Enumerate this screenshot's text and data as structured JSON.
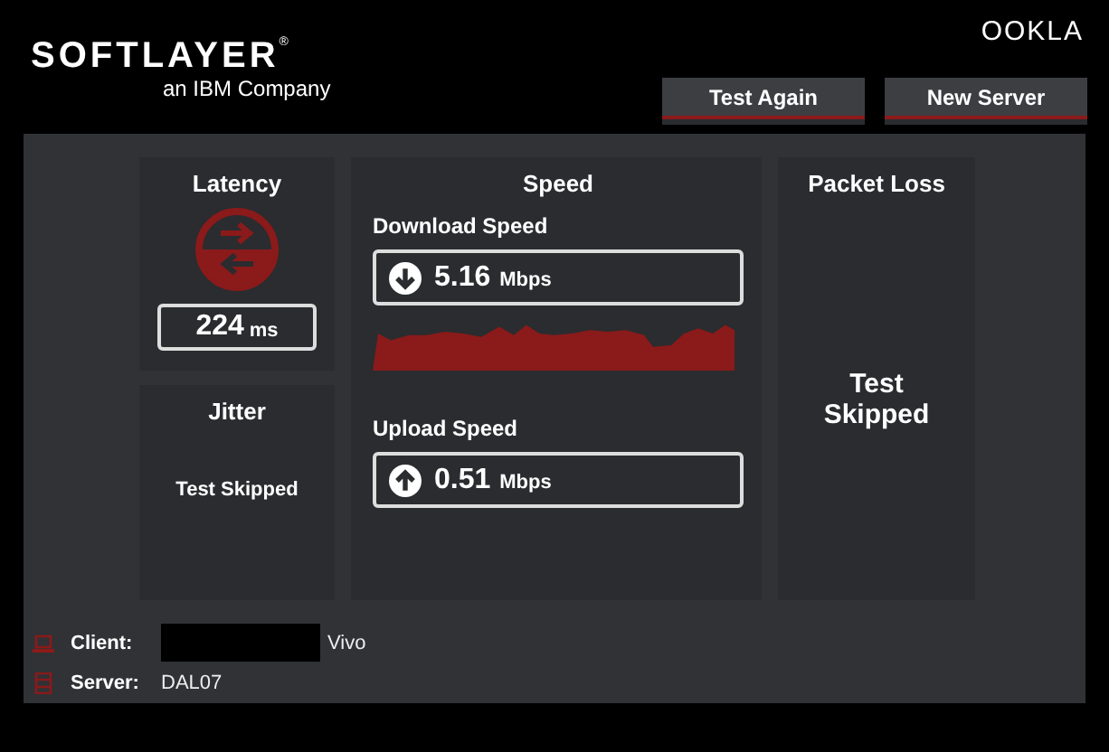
{
  "brand": {
    "name": "SOFTLAYER",
    "mark": "®",
    "tagline": "an IBM Company",
    "partner": "OOKLA"
  },
  "buttons": [
    {
      "label": "Test Again"
    },
    {
      "label": "New Server"
    }
  ],
  "latency": {
    "title": "Latency",
    "value": "224",
    "unit": "ms"
  },
  "jitter": {
    "title": "Jitter",
    "result": "Test Skipped"
  },
  "speed": {
    "title": "Speed",
    "sections": [
      {
        "kind": "download",
        "label": "Download Speed",
        "value": "5.16",
        "unit": "Mbps"
      },
      {
        "kind": "upload",
        "label": "Upload Speed",
        "value": "0.51",
        "unit": "Mbps"
      }
    ]
  },
  "packet_loss": {
    "title": "Packet Loss",
    "result": "Test Skipped"
  },
  "info": [
    {
      "kind": "client",
      "label": "Client:",
      "value": "Vivo",
      "redacted": true
    },
    {
      "kind": "server",
      "label": "Server:",
      "value": "DAL07",
      "redacted": false
    }
  ]
}
